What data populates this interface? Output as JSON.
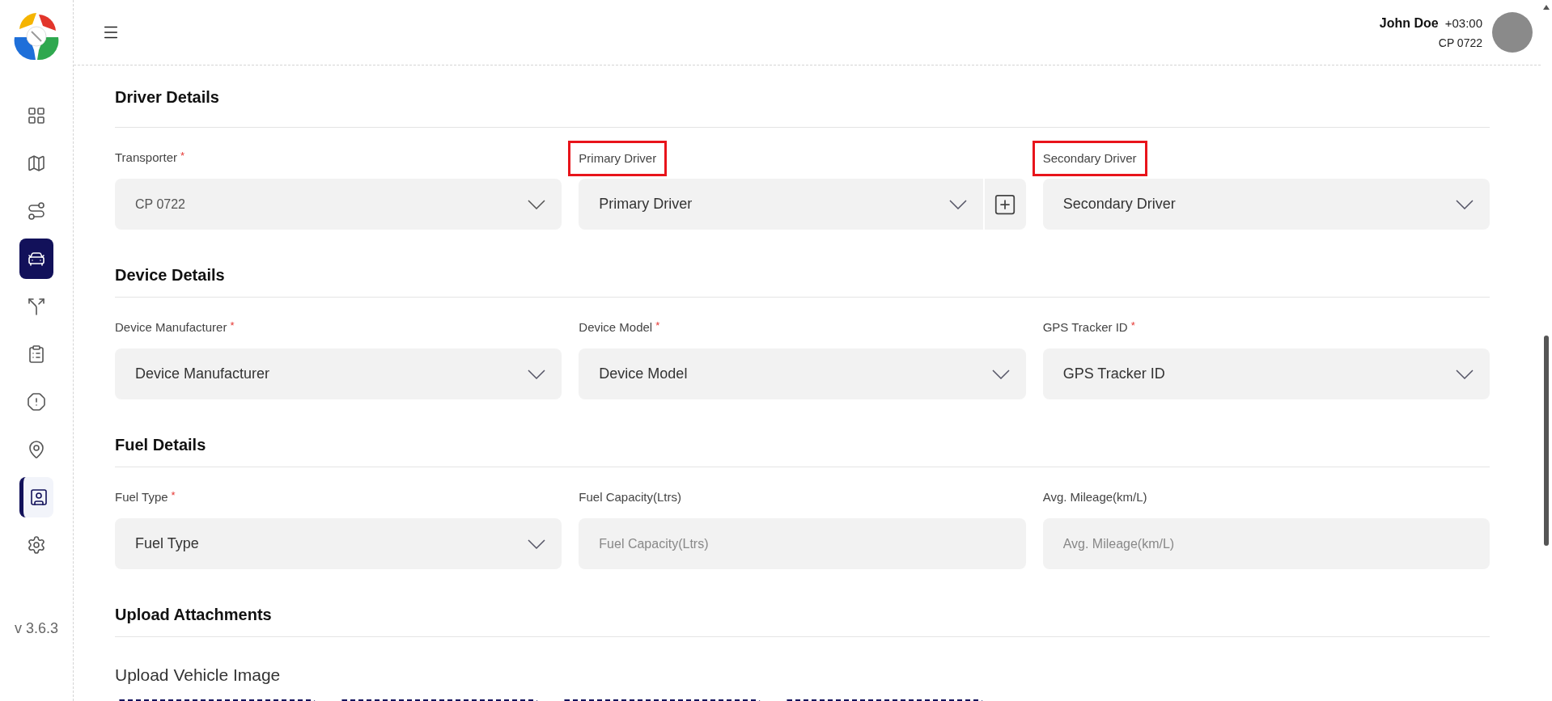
{
  "header": {
    "user_name": "John Doe",
    "timezone": "+03:00",
    "account": "CP 0722"
  },
  "sidebar": {
    "items": [
      {
        "selected": false,
        "highlighted": false
      },
      {
        "selected": false,
        "highlighted": false
      },
      {
        "selected": false,
        "highlighted": false
      },
      {
        "selected": true,
        "highlighted": false
      },
      {
        "selected": false,
        "highlighted": false
      },
      {
        "selected": false,
        "highlighted": false
      },
      {
        "selected": false,
        "highlighted": false
      },
      {
        "selected": false,
        "highlighted": false
      },
      {
        "selected": false,
        "highlighted": true
      },
      {
        "selected": false,
        "highlighted": false
      }
    ],
    "version": "v 3.6.3"
  },
  "sections": [
    {
      "title": "Driver Details",
      "fields": [
        {
          "label": "Transporter",
          "required_mark": "*",
          "highlighted": false,
          "kind": "select",
          "value": "CP 0722",
          "disabled": true
        },
        {
          "label": "Primary Driver",
          "highlighted": true,
          "kind": "select",
          "placeholder": "Primary Driver",
          "disabled": false,
          "add_button": true
        },
        {
          "label": "Secondary Driver",
          "highlighted": true,
          "kind": "select",
          "placeholder": "Secondary Driver",
          "disabled": false
        }
      ]
    },
    {
      "title": "Device Details",
      "fields": [
        {
          "label": "Device Manufacturer",
          "required_mark": "*",
          "highlighted": false,
          "kind": "select",
          "placeholder": "Device Manufacturer",
          "disabled": false
        },
        {
          "label": "Device Model",
          "required_mark": "*",
          "highlighted": false,
          "kind": "select",
          "placeholder": "Device Model",
          "disabled": false
        },
        {
          "label": "GPS Tracker ID",
          "required_mark": "*",
          "highlighted": false,
          "kind": "select",
          "placeholder": "GPS Tracker ID",
          "disabled": false
        }
      ]
    },
    {
      "title": "Fuel Details",
      "fields": [
        {
          "label": "Fuel Type",
          "required_mark": "*",
          "highlighted": false,
          "kind": "select",
          "placeholder": "Fuel Type",
          "disabled": false
        },
        {
          "label": "Fuel Capacity(Ltrs)",
          "highlighted": false,
          "kind": "input",
          "placeholder": "Fuel Capacity(Ltrs)"
        },
        {
          "label": "Avg. Mileage(km/L)",
          "highlighted": false,
          "kind": "input",
          "placeholder": "Avg. Mileage(km/L)"
        }
      ]
    },
    {
      "title": "Upload Attachments",
      "upload_groups": [
        {
          "title": "Upload Vehicle Image",
          "slots": [
            {
              "filled": false
            },
            {
              "filled": false
            },
            {
              "filled": false
            },
            {
              "filled": false
            }
          ]
        }
      ]
    }
  ]
}
